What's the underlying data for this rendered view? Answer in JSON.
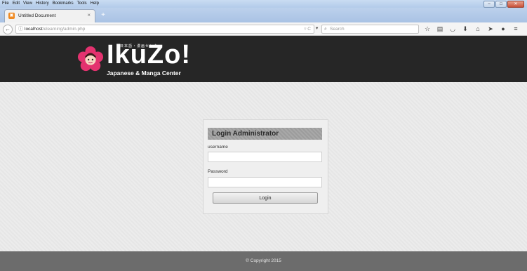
{
  "menu": [
    "File",
    "Edit",
    "View",
    "History",
    "Bookmarks",
    "Tools",
    "Help"
  ],
  "window_controls": {
    "minimize": "–",
    "maximize": "□",
    "close": "✕"
  },
  "tab": {
    "title": "Untitled Document",
    "close": "×",
    "new_tab": "+"
  },
  "navbar": {
    "back": "←",
    "url_host": "localhost",
    "url_path": "/elearning/admin.php",
    "url_controls": "▿ C",
    "search_placeholder": "Search",
    "toolbar_icons": [
      "star-icon",
      "reading-list-icon",
      "pocket-icon",
      "download-icon",
      "home-icon",
      "send-icon",
      "chat-icon",
      "menu-icon"
    ]
  },
  "header": {
    "logo_word": "IkuZo!",
    "logo_japanese": "日本語・漫画センター",
    "logo_subtitle": "Japanese & Manga Center"
  },
  "login": {
    "heading": "Login Administrator",
    "username_label": "username",
    "username_value": "",
    "password_label": "Password",
    "password_value": "",
    "button": "Login"
  },
  "footer": {
    "copyright": "© Copyright 2015"
  },
  "colors": {
    "header_bg": "#262626",
    "footer_bg": "#6c6c6c",
    "logo_flower": "#e4326f",
    "tab_favicon": "#f08a22"
  }
}
